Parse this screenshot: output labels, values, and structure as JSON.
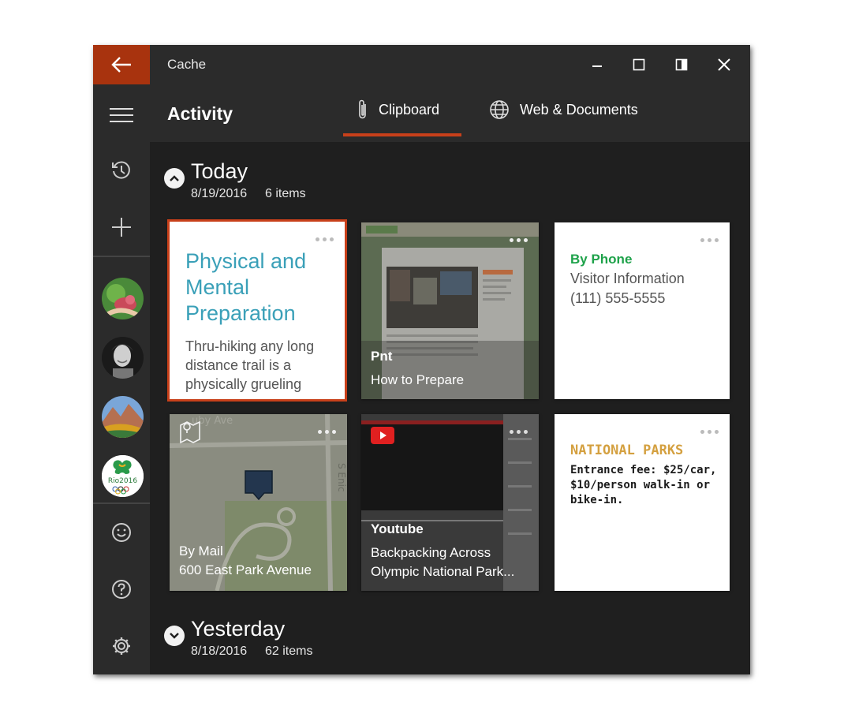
{
  "window": {
    "app_title": "Cache"
  },
  "header": {
    "page_title": "Activity",
    "tabs": [
      {
        "label": "Clipboard",
        "icon": "paperclip-icon",
        "active": true
      },
      {
        "label": "Web & Documents",
        "icon": "globe-icon",
        "active": false
      }
    ]
  },
  "sidebar": {
    "items": [
      {
        "icon": "back-arrow-icon"
      },
      {
        "icon": "hamburger-menu-icon"
      },
      {
        "icon": "history-icon"
      },
      {
        "icon": "add-icon"
      },
      {
        "icon": "smiley-icon"
      },
      {
        "icon": "help-icon"
      },
      {
        "icon": "settings-icon"
      }
    ],
    "avatars": [
      "avatar-flowers",
      "avatar-person",
      "avatar-mountains",
      "avatar-rio2016"
    ]
  },
  "groups": [
    {
      "title": "Today",
      "date": "8/19/2016",
      "count": "6 items",
      "cards": [
        {
          "type": "text",
          "title": "Physical and Mental Preparation",
          "body": "Thru-hiking any long distance trail is a physically grueling"
        },
        {
          "type": "web",
          "source": "Pnt",
          "caption": "How to Prepare"
        },
        {
          "type": "contact",
          "heading": "By Phone",
          "line1": "Visitor Information",
          "line2": "(111) 555-5555"
        },
        {
          "type": "map",
          "line1": "By Mail",
          "line2": "600 East Park Avenue"
        },
        {
          "type": "video",
          "source": "Youtube",
          "caption_line1": "Backpacking Across",
          "caption_line2": "Olympic National Park..."
        },
        {
          "type": "note",
          "heading": "NATIONAL PARKS",
          "body": "Entrance fee: $25/car, $10/person walk-in or bike-in."
        }
      ]
    },
    {
      "title": "Yesterday",
      "date": "8/18/2016",
      "count": "62 items"
    }
  ],
  "colors": {
    "accent": "#c8401a",
    "back_button": "#a8330e",
    "title_teal": "#3aa0b8",
    "phone_green": "#1ea24a",
    "parks_orange": "#d4a040"
  }
}
